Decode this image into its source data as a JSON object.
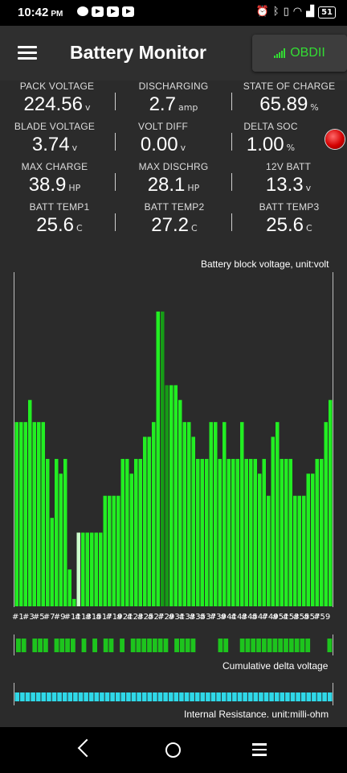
{
  "status_bar": {
    "time": "10:42",
    "ampm": "PM",
    "battery_level": "51",
    "notification_icons": [
      "chat-bubble-icon",
      "youtube-icon",
      "youtube-icon",
      "youtube-icon"
    ],
    "system_icons": [
      "alarm-icon",
      "bluetooth-icon",
      "vibrate-icon",
      "wifi-icon",
      "signal-icon",
      "battery-icon"
    ]
  },
  "app_bar": {
    "title": "Battery Monitor",
    "menu_icon": "hamburger-menu-icon",
    "connection_label": "OBDII",
    "connection_color": "#33dd33"
  },
  "metrics": [
    {
      "label": "PACK VOLTAGE",
      "value": "224.56",
      "unit": "v"
    },
    {
      "label": "DISCHARGING",
      "value": "2.7",
      "unit": "amp"
    },
    {
      "label": "STATE OF CHARGE",
      "value": "65.89",
      "unit": "%"
    },
    {
      "label": "BLADE VOLTAGE",
      "value": "3.74",
      "unit": "v"
    },
    {
      "label": "VOLT DIFF",
      "value": "0.00",
      "unit": "v"
    },
    {
      "label": "DELTA SOC",
      "value": "1.00",
      "unit": "%"
    },
    {
      "label": "MAX CHARGE",
      "value": "38.9",
      "unit": "HP"
    },
    {
      "label": "MAX DISCHRG",
      "value": "28.1",
      "unit": "HP"
    },
    {
      "label": "12V BATT",
      "value": "13.3",
      "unit": "v"
    },
    {
      "label": "BATT TEMP1",
      "value": "25.6",
      "unit": "C"
    },
    {
      "label": "BATT TEMP2",
      "value": "27.2",
      "unit": "C"
    },
    {
      "label": "BATT TEMP3",
      "value": "25.6",
      "unit": "C"
    }
  ],
  "record_button": {
    "color": "#d40000"
  },
  "colors": {
    "bar": "#22ee22",
    "bar_dark": "#169c16",
    "bar_min": "#ccffcc",
    "delta": "#1dc41d",
    "resistance": "#2fd8e8"
  },
  "chart_data": [
    {
      "type": "bar",
      "title": "Battery block voltage, unit:volt",
      "xlabel": "",
      "ylabel": "",
      "categories": [
        "#1",
        "#2",
        "#3",
        "#4",
        "#5",
        "#6",
        "#7",
        "#8",
        "#9",
        "#10",
        "#11",
        "#12",
        "#13",
        "#14",
        "#15",
        "#16",
        "#17",
        "#18",
        "#19",
        "#20",
        "#21",
        "#22",
        "#23",
        "#24",
        "#25",
        "#26",
        "#27",
        "#28",
        "#29",
        "#30",
        "#31",
        "#32",
        "#33",
        "#34",
        "#35",
        "#36",
        "#37",
        "#38",
        "#39",
        "#40",
        "#41",
        "#42",
        "#43",
        "#44",
        "#45",
        "#46",
        "#47",
        "#48",
        "#49",
        "#50",
        "#51",
        "#52",
        "#53",
        "#54",
        "#55",
        "#56",
        "#57",
        "#58",
        "#59",
        "#60"
      ],
      "values": [
        5,
        5,
        5,
        5.6,
        5,
        5,
        5,
        4,
        2.4,
        4,
        3.6,
        4,
        1,
        0.2,
        2,
        2,
        2,
        2,
        2,
        2,
        3,
        3,
        3,
        3,
        4,
        4,
        3.6,
        4,
        4,
        4.6,
        4.6,
        5,
        8,
        8,
        6,
        6,
        6,
        5.6,
        5,
        5,
        4.6,
        4,
        4,
        4,
        5,
        5,
        4,
        5,
        4,
        4,
        4,
        5,
        4,
        4,
        4,
        3.6,
        4,
        3,
        4.6,
        5,
        4,
        4,
        4,
        3,
        3,
        3,
        3.6,
        3.6,
        4,
        4,
        5,
        5.6
      ],
      "highlight_max": [
        33,
        34
      ],
      "highlight_min": [
        14
      ],
      "ylim": [
        0,
        8.5
      ]
    },
    {
      "type": "bar",
      "title": "Cumulative delta voltage",
      "categories_count": 60,
      "values": [
        1,
        1,
        0,
        1,
        1,
        1,
        0,
        1,
        1,
        1,
        1,
        0,
        1,
        0,
        1,
        0,
        1,
        1,
        0,
        1,
        0,
        1,
        1,
        1,
        1,
        1,
        1,
        1,
        0,
        1,
        1,
        1,
        1,
        0,
        0,
        0,
        0,
        1,
        1,
        0,
        0,
        1,
        1,
        1,
        1,
        1,
        1,
        1,
        1,
        1,
        1,
        1,
        1,
        1,
        0,
        0,
        0,
        1
      ]
    },
    {
      "type": "bar",
      "title": "Internal Resistance. unit:milli-ohm",
      "categories_count": 60,
      "values_uniform": true
    }
  ],
  "nav_bar": {
    "back": "back-icon",
    "home": "home-icon",
    "recents": "recents-icon"
  }
}
